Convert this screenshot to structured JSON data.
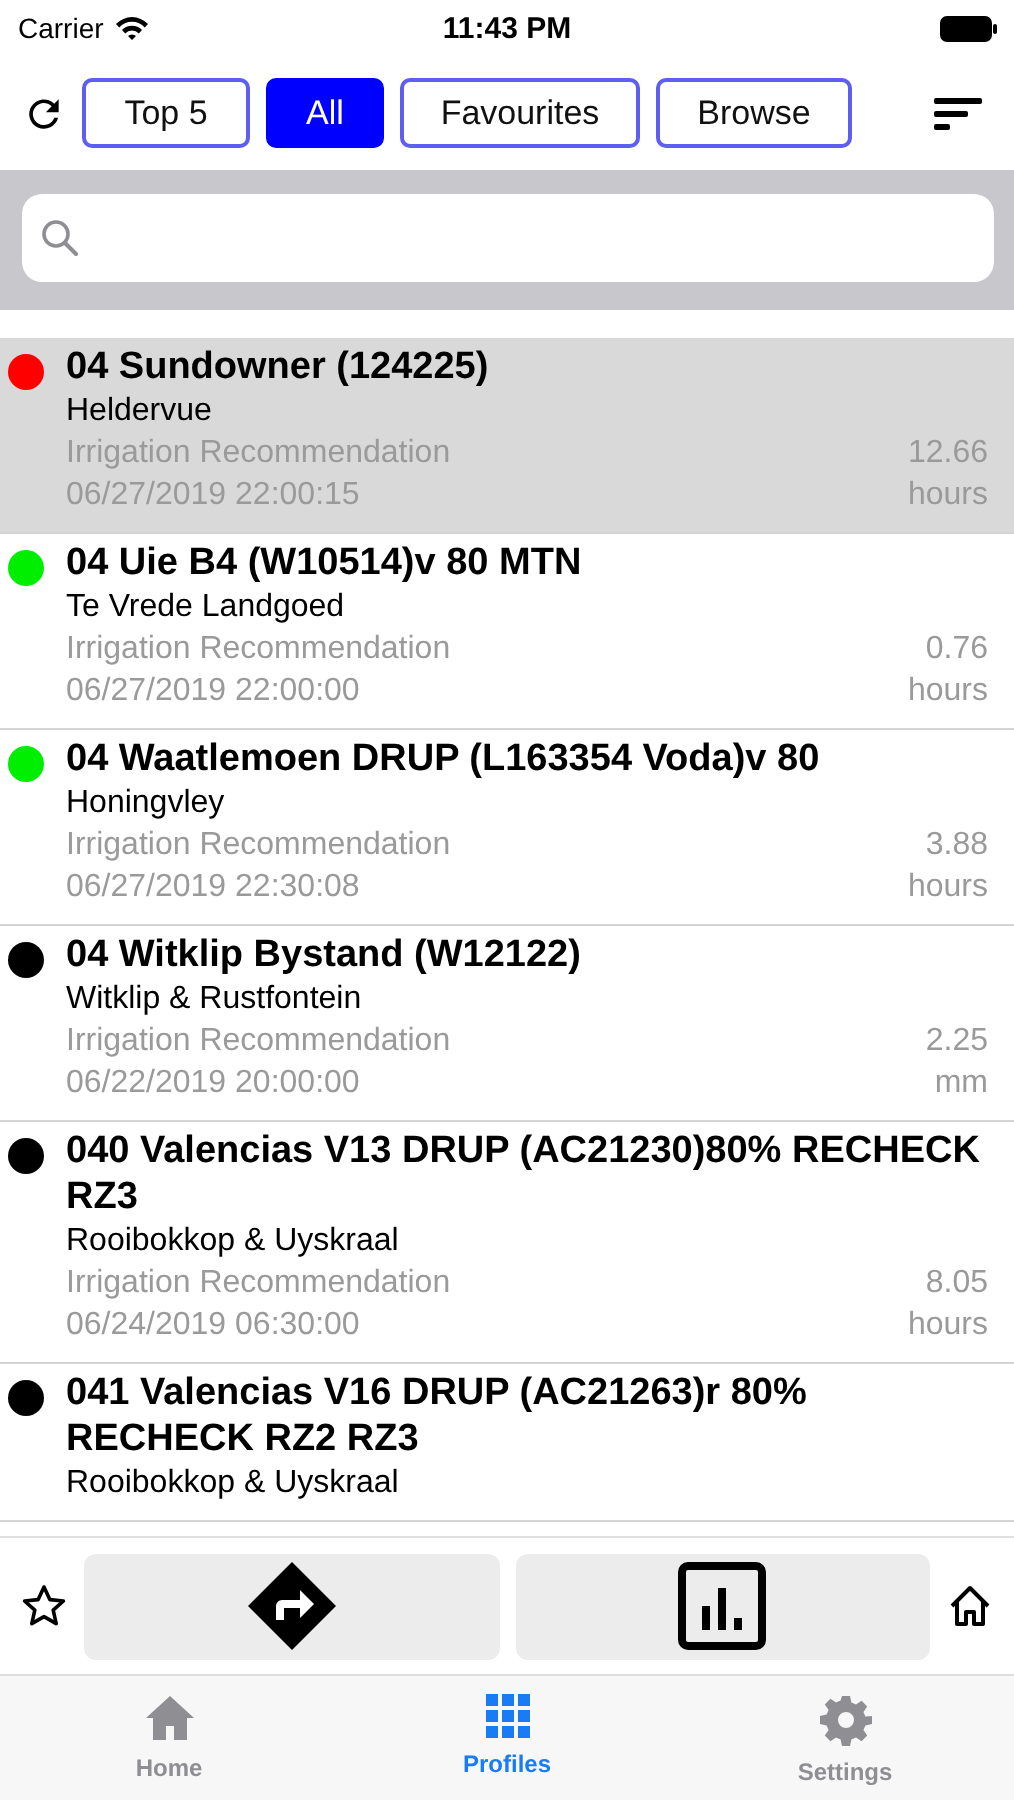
{
  "status_bar": {
    "carrier": "Carrier",
    "time": "11:43 PM"
  },
  "filters": [
    {
      "label": "Top 5",
      "selected": false
    },
    {
      "label": "All",
      "selected": true
    },
    {
      "label": "Favourites",
      "selected": false
    },
    {
      "label": "Browse",
      "selected": false
    }
  ],
  "profiles": [
    {
      "title": "04 Sundowner (124225)",
      "farm": "Heldervue",
      "label": "Irrigation Recommendation",
      "value": "12.66",
      "date": "06/27/2019 22:00:15",
      "unit": "hours",
      "color": "#ff0000",
      "selected": true
    },
    {
      "title": "04 Uie B4 (W10514)v 80 MTN",
      "farm": "Te Vrede Landgoed",
      "label": "Irrigation Recommendation",
      "value": "0.76",
      "date": "06/27/2019 22:00:00",
      "unit": "hours",
      "color": "#00ee00",
      "selected": false
    },
    {
      "title": "04 Waatlemoen DRUP (L163354 Voda)v 80",
      "farm": "Honingvley",
      "label": "Irrigation Recommendation",
      "value": "3.88",
      "date": "06/27/2019 22:30:08",
      "unit": "hours",
      "color": "#00ee00",
      "selected": false
    },
    {
      "title": "04 Witklip Bystand (W12122)",
      "farm": "Witklip & Rustfontein",
      "label": "Irrigation Recommendation",
      "value": "2.25",
      "date": "06/22/2019 20:00:00",
      "unit": "mm",
      "color": "#000000",
      "selected": false
    },
    {
      "title": "040 Valencias V13 DRUP (AC21230)80% RECHECK RZ3",
      "farm": "Rooibokkop & Uyskraal",
      "label": "Irrigation Recommendation",
      "value": "8.05",
      "date": "06/24/2019 06:30:00",
      "unit": "hours",
      "color": "#000000",
      "selected": false
    },
    {
      "title": "041 Valencias V16 DRUP (AC21263)r 80% RECHECK RZ2 RZ3",
      "farm": "Rooibokkop & Uyskraal",
      "color": "#000000",
      "selected": false
    }
  ],
  "tab_bar": [
    {
      "label": "Home",
      "selected": false
    },
    {
      "label": "Profiles",
      "selected": true
    },
    {
      "label": "Settings",
      "selected": false
    }
  ]
}
